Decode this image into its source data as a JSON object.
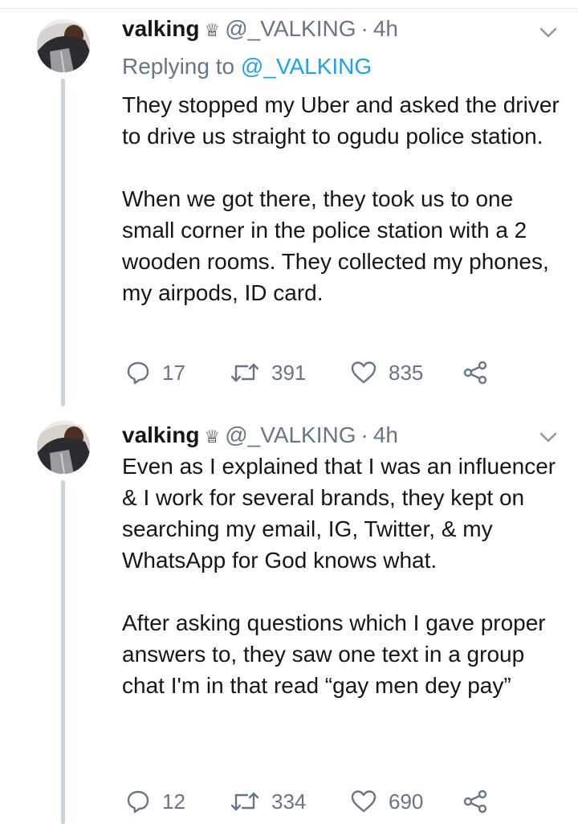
{
  "tweets": [
    {
      "display_name": "valking",
      "badge_icon": "crown-icon",
      "handle": "@_VALKING",
      "separator": "·",
      "time": "4h",
      "replying_prefix": "Replying to",
      "replying_to": "@_VALKING",
      "paragraphs": [
        "They stopped my Uber and asked the driver to drive us straight to ogudu police station.",
        "When we got there, they took us to one small corner in the police station with a 2 wooden rooms. They collected my phones, my airpods, ID card."
      ],
      "replies": "17",
      "retweets": "391",
      "likes": "835"
    },
    {
      "display_name": "valking",
      "badge_icon": "crown-icon",
      "handle": "@_VALKING",
      "separator": "·",
      "time": "4h",
      "paragraphs": [
        "Even as I explained that I was an influencer & I work for several brands, they kept on searching my email, IG, Twitter, & my WhatsApp for God knows what.",
        "After asking questions which I gave proper answers to, they saw one text in a group chat I'm in that read “gay men dey pay”"
      ],
      "replies": "12",
      "retweets": "334",
      "likes": "690"
    }
  ],
  "colors": {
    "text": "#14171a",
    "secondary": "#657786",
    "link": "#1da1f2",
    "thread_line": "#cbd4da"
  }
}
